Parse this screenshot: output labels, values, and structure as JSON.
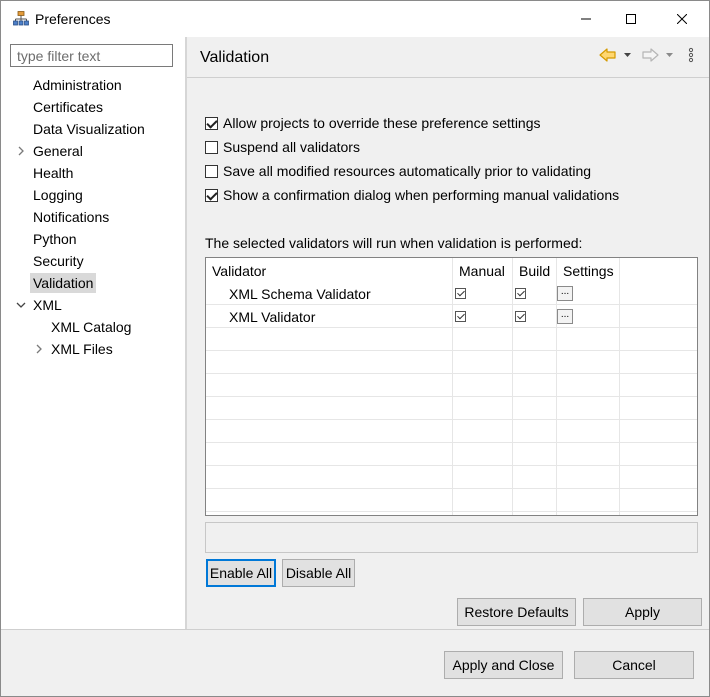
{
  "window": {
    "title": "Preferences",
    "app_icon": "preferences-icon",
    "controls": [
      "minimize-icon",
      "maximize-icon",
      "close-icon"
    ]
  },
  "sidebar": {
    "filter_placeholder": "type filter text",
    "items": [
      {
        "label": "Administration",
        "level": 0,
        "expander": "none"
      },
      {
        "label": "Certificates",
        "level": 0,
        "expander": "none"
      },
      {
        "label": "Data Visualization",
        "level": 0,
        "expander": "none"
      },
      {
        "label": "General",
        "level": 0,
        "expander": "collapsed"
      },
      {
        "label": "Health",
        "level": 0,
        "expander": "none"
      },
      {
        "label": "Logging",
        "level": 0,
        "expander": "none"
      },
      {
        "label": "Notifications",
        "level": 0,
        "expander": "none"
      },
      {
        "label": "Python",
        "level": 0,
        "expander": "none"
      },
      {
        "label": "Security",
        "level": 0,
        "expander": "none"
      },
      {
        "label": "Validation",
        "level": 0,
        "expander": "none",
        "selected": true
      },
      {
        "label": "XML",
        "level": 0,
        "expander": "expanded"
      },
      {
        "label": "XML Catalog",
        "level": 1,
        "expander": "none"
      },
      {
        "label": "XML Files",
        "level": 1,
        "expander": "collapsed"
      }
    ]
  },
  "page": {
    "title": "Validation",
    "nav_icons": [
      "back-arrow-icon",
      "back-dropdown-icon",
      "forward-arrow-icon",
      "forward-dropdown-icon",
      "view-menu-icon"
    ],
    "options": [
      {
        "label": "Allow projects to override these preference settings",
        "checked": true
      },
      {
        "label": "Suspend all validators",
        "checked": false
      },
      {
        "label": "Save all modified resources automatically prior to validating",
        "checked": false
      },
      {
        "label": "Show a confirmation dialog when performing manual validations",
        "checked": true
      }
    ],
    "validators_label": "The selected validators will run when validation is performed:",
    "table": {
      "columns": [
        "Validator",
        "Manual",
        "Build",
        "Settings"
      ],
      "rows": [
        {
          "name": "XML Schema Validator",
          "manual": true,
          "build": true,
          "settings_label": "..."
        },
        {
          "name": "XML Validator",
          "manual": true,
          "build": true,
          "settings_label": "..."
        }
      ]
    },
    "enable_all": "Enable All",
    "disable_all": "Disable All",
    "restore_defaults": "Restore Defaults",
    "apply": "Apply"
  },
  "footer": {
    "apply_and_close": "Apply and Close",
    "cancel": "Cancel"
  },
  "colors": {
    "accent_focus": "#0078d7",
    "nav_arrow": "#e8a200",
    "selected_bg": "#d9d9d9"
  }
}
